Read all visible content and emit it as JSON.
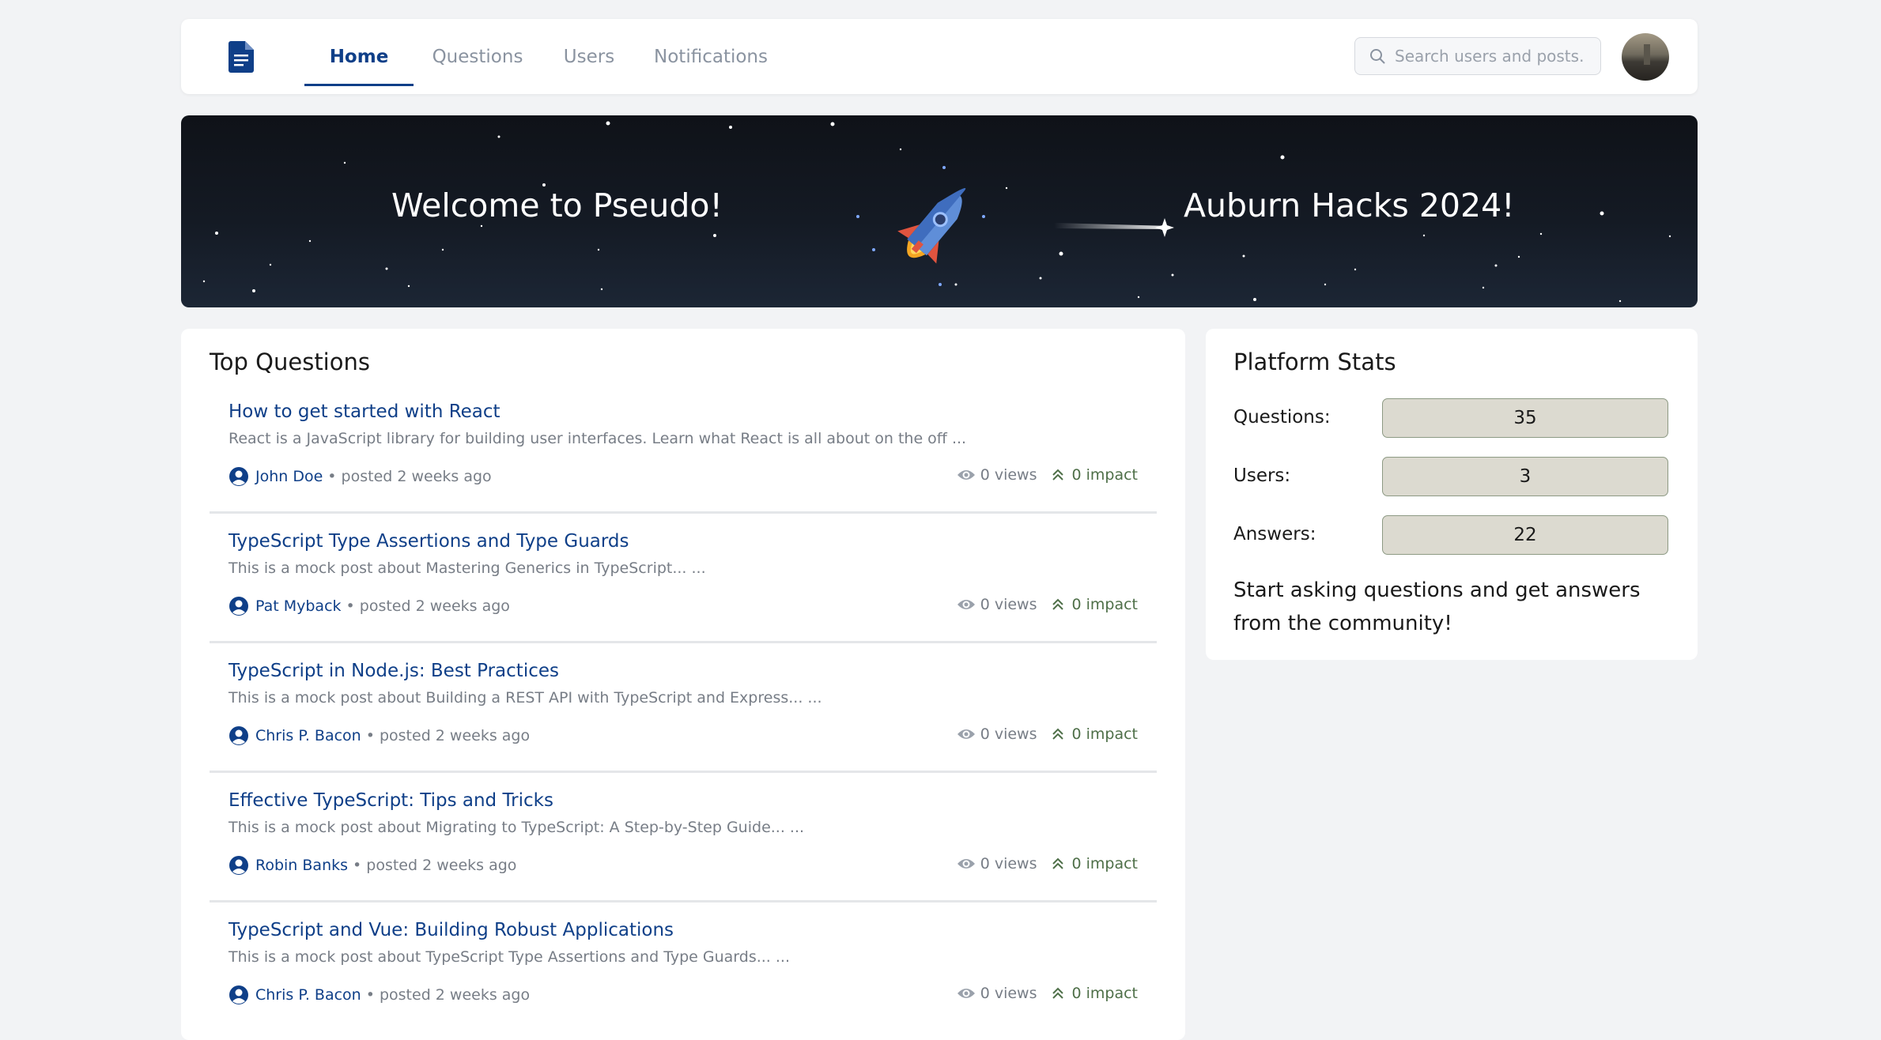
{
  "nav": {
    "tabs": [
      {
        "label": "Home",
        "active": true
      },
      {
        "label": "Questions",
        "active": false
      },
      {
        "label": "Users",
        "active": false
      },
      {
        "label": "Notifications",
        "active": false
      }
    ],
    "search_placeholder": "Search users and posts...",
    "accent_color": "#0f3f88"
  },
  "banner": {
    "left_text": "Welcome to Pseudo!",
    "right_text": "Auburn Hacks 2024!"
  },
  "top_questions": {
    "title": "Top Questions",
    "items": [
      {
        "title": "How to get started with React",
        "excerpt": "React is a JavaScript library for building user interfaces. Learn what React is all about on the off ...",
        "author": "John Doe",
        "posted": "• posted 2 weeks ago",
        "views": "0 views",
        "impact": "0 impact"
      },
      {
        "title": "TypeScript Type Assertions and Type Guards",
        "excerpt": "This is a mock post about Mastering Generics in TypeScript... ...",
        "author": "Pat Myback",
        "posted": "• posted 2 weeks ago",
        "views": "0 views",
        "impact": "0 impact"
      },
      {
        "title": "TypeScript in Node.js: Best Practices",
        "excerpt": "This is a mock post about Building a REST API with TypeScript and Express... ...",
        "author": "Chris P. Bacon",
        "posted": "• posted 2 weeks ago",
        "views": "0 views",
        "impact": "0 impact"
      },
      {
        "title": "Effective TypeScript: Tips and Tricks",
        "excerpt": "This is a mock post about Migrating to TypeScript: A Step-by-Step Guide... ...",
        "author": "Robin Banks",
        "posted": "• posted 2 weeks ago",
        "views": "0 views",
        "impact": "0 impact"
      },
      {
        "title": "TypeScript and Vue: Building Robust Applications",
        "excerpt": "This is a mock post about TypeScript Type Assertions and Type Guards... ...",
        "author": "Chris P. Bacon",
        "posted": "• posted 2 weeks ago",
        "views": "0 views",
        "impact": "0 impact"
      }
    ]
  },
  "platform_stats": {
    "title": "Platform Stats",
    "rows": [
      {
        "label": "Questions:",
        "value": "35"
      },
      {
        "label": "Users:",
        "value": "3"
      },
      {
        "label": "Answers:",
        "value": "22"
      }
    ],
    "blurb": "Start asking questions and get answers from the community!"
  }
}
